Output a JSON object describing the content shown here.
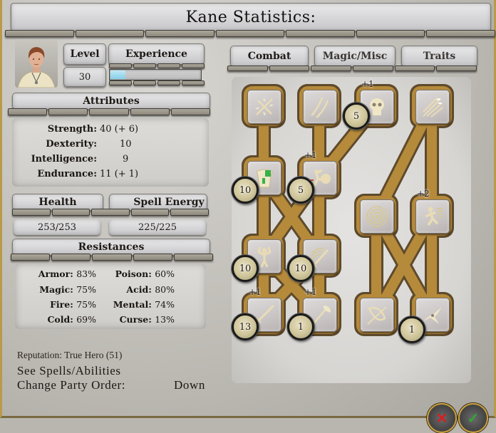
{
  "window": {
    "title": "Kane Statistics:"
  },
  "character": {
    "level_label": "Level",
    "level_value": "30",
    "experience_label": "Experience",
    "experience_progress": 0.17
  },
  "attributes": {
    "header": "Attributes",
    "rows": [
      {
        "name": "Strength:",
        "value": "40  (+ 6)"
      },
      {
        "name": "Dexterity:",
        "value": "10"
      },
      {
        "name": "Intelligence:",
        "value": "9"
      },
      {
        "name": "Endurance:",
        "value": "11  (+ 1)"
      }
    ]
  },
  "vitals": {
    "health_label": "Health",
    "health_value": "253/253",
    "spell_energy_label": "Spell Energy",
    "spell_energy_value": "225/225"
  },
  "resistances": {
    "header": "Resistances",
    "left": [
      {
        "name": "Armor:",
        "value": "83%"
      },
      {
        "name": "Magic:",
        "value": "75%"
      },
      {
        "name": "Fire:",
        "value": "75%"
      },
      {
        "name": "Cold:",
        "value": "69%"
      }
    ],
    "right": [
      {
        "name": "Poison:",
        "value": "60%"
      },
      {
        "name": "Acid:",
        "value": "80%"
      },
      {
        "name": "Mental:",
        "value": "74%"
      },
      {
        "name": "Curse:",
        "value": "13%"
      }
    ]
  },
  "footer": {
    "reputation": "Reputation: True Hero (51)",
    "see_spells": "See Spells/Abilities",
    "party_order_label": "Change Party Order:",
    "party_order_value": "Down"
  },
  "tabs": [
    {
      "label": "Combat",
      "active": true
    },
    {
      "label": "Magic/Misc",
      "active": false
    },
    {
      "label": "Traits",
      "active": false
    }
  ],
  "skills": [
    {
      "id": "critical-strike",
      "icon": "crossed-swords-sparks-icon",
      "level": null,
      "bonus": null
    },
    {
      "id": "dual-wield",
      "icon": "twin-blades-icon",
      "level": null,
      "bonus": null
    },
    {
      "id": "lethal-strike",
      "icon": "skull-icon",
      "level": "5",
      "bonus": "+1"
    },
    {
      "id": "multi-shot",
      "icon": "arrows-volley-icon",
      "level": null,
      "bonus": null
    },
    {
      "id": "armor-training",
      "icon": "armor-icon",
      "level": "10",
      "bonus": null
    },
    {
      "id": "shield-bash",
      "icon": "shield-charge-icon",
      "level": "5",
      "bonus": "+1"
    },
    {
      "id": "concentration",
      "icon": "target-rings-icon",
      "level": null,
      "bonus": null
    },
    {
      "id": "dodge",
      "icon": "running-figure-icon",
      "level": null,
      "bonus": "+2"
    },
    {
      "id": "might",
      "icon": "flexing-figure-icon",
      "level": "10",
      "bonus": null
    },
    {
      "id": "parry",
      "icon": "sword-swing-icon",
      "level": "10",
      "bonus": null
    },
    {
      "id": "swords",
      "icon": "sword-icon",
      "level": "13",
      "bonus": "+1"
    },
    {
      "id": "axes",
      "icon": "axe-icon",
      "level": "1",
      "bonus": "+1"
    },
    {
      "id": "bows",
      "icon": "bow-icon",
      "level": null,
      "bonus": null
    },
    {
      "id": "thrown",
      "icon": "shuriken-icon",
      "level": "1",
      "bonus": null
    }
  ],
  "buttons": {
    "cancel_symbol": "✕",
    "accept_symbol": "✓"
  },
  "colors": {
    "path_fill": "#b58a3a",
    "path_edge": "#5e4a2c",
    "exp_bar": "#8fd3ea",
    "frame_gold": "#b89a4a"
  }
}
